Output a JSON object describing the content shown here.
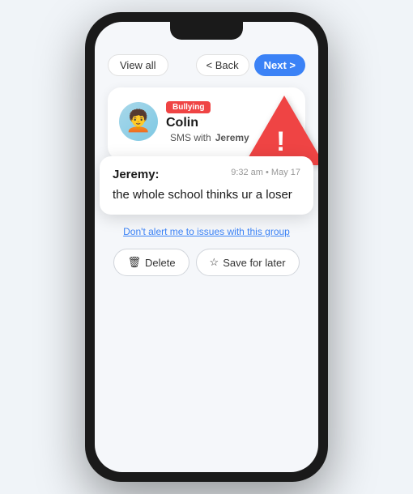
{
  "header": {
    "view_all_label": "View all",
    "back_label": "< Back",
    "next_label": "Next >"
  },
  "alert": {
    "badge_label": "Bullying",
    "contact_name": "Colin",
    "sms_label": "SMS with",
    "sms_contact": "Jeremy",
    "avatar_emoji": "🧑‍🦱"
  },
  "message": {
    "sender": "Jeremy:",
    "timestamp": "9:32 am • May 17",
    "text": "the whole school thinks ur a loser"
  },
  "actions": {
    "dont_alert_label": "Don't alert me to issues with this group",
    "delete_label": "Delete",
    "save_label": "Save for later",
    "delete_icon": "🗑",
    "save_icon": "☆"
  }
}
